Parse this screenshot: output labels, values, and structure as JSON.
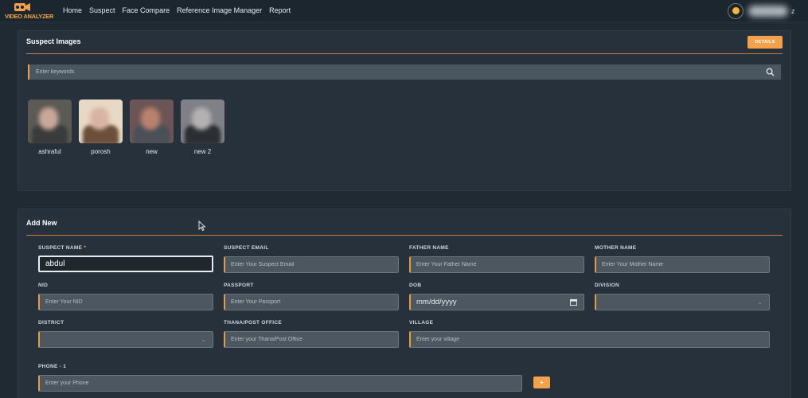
{
  "app": {
    "logo_text": "VIDEO ANALYZER",
    "nav": [
      "Home",
      "Suspect",
      "Face Compare",
      "Reference Image Manager",
      "Report"
    ],
    "user_name": "z",
    "colors": {
      "accent": "#f3a24b",
      "background": "#1f2a33",
      "panel": "#26313b",
      "field": "#4d5760"
    }
  },
  "suspect_images": {
    "title": "Suspect Images",
    "details_label": "DETAILS",
    "search_placeholder": "Enter keywords",
    "search_icon": "search-icon",
    "thumbnails": [
      {
        "label": "ashraful"
      },
      {
        "label": "porosh"
      },
      {
        "label": "new"
      },
      {
        "label": "new 2"
      }
    ]
  },
  "add_new": {
    "title": "Add New",
    "fields": {
      "suspect_name": {
        "label": "SUSPECT NAME",
        "required_mark": "*",
        "value": "abdul"
      },
      "suspect_email": {
        "label": "SUSPECT EMAIL",
        "placeholder": "Enter Your Suspect Email"
      },
      "father_name": {
        "label": "FATHER NAME",
        "placeholder": "Enter Your Father Name"
      },
      "mother_name": {
        "label": "MOTHER NAME",
        "placeholder": "Enter Your Mother Name"
      },
      "nid": {
        "label": "NID",
        "placeholder": "Enter Your NID"
      },
      "passport": {
        "label": "PASSPORT",
        "placeholder": "Enter Your Passport"
      },
      "dob": {
        "label": "DOB",
        "value": "mm/dd/yyyy"
      },
      "division": {
        "label": "DIVISION",
        "value": ""
      },
      "district": {
        "label": "DISTRICT",
        "value": ""
      },
      "thana": {
        "label": "THANA/POST OFFICE",
        "placeholder": "Enter your Thana/Post Office"
      },
      "village": {
        "label": "VILLAGE",
        "placeholder": "Enter your village"
      },
      "phone": {
        "label": "PHONE - 1",
        "placeholder": "Enter your Phone"
      }
    },
    "add_phone_label": "+"
  }
}
